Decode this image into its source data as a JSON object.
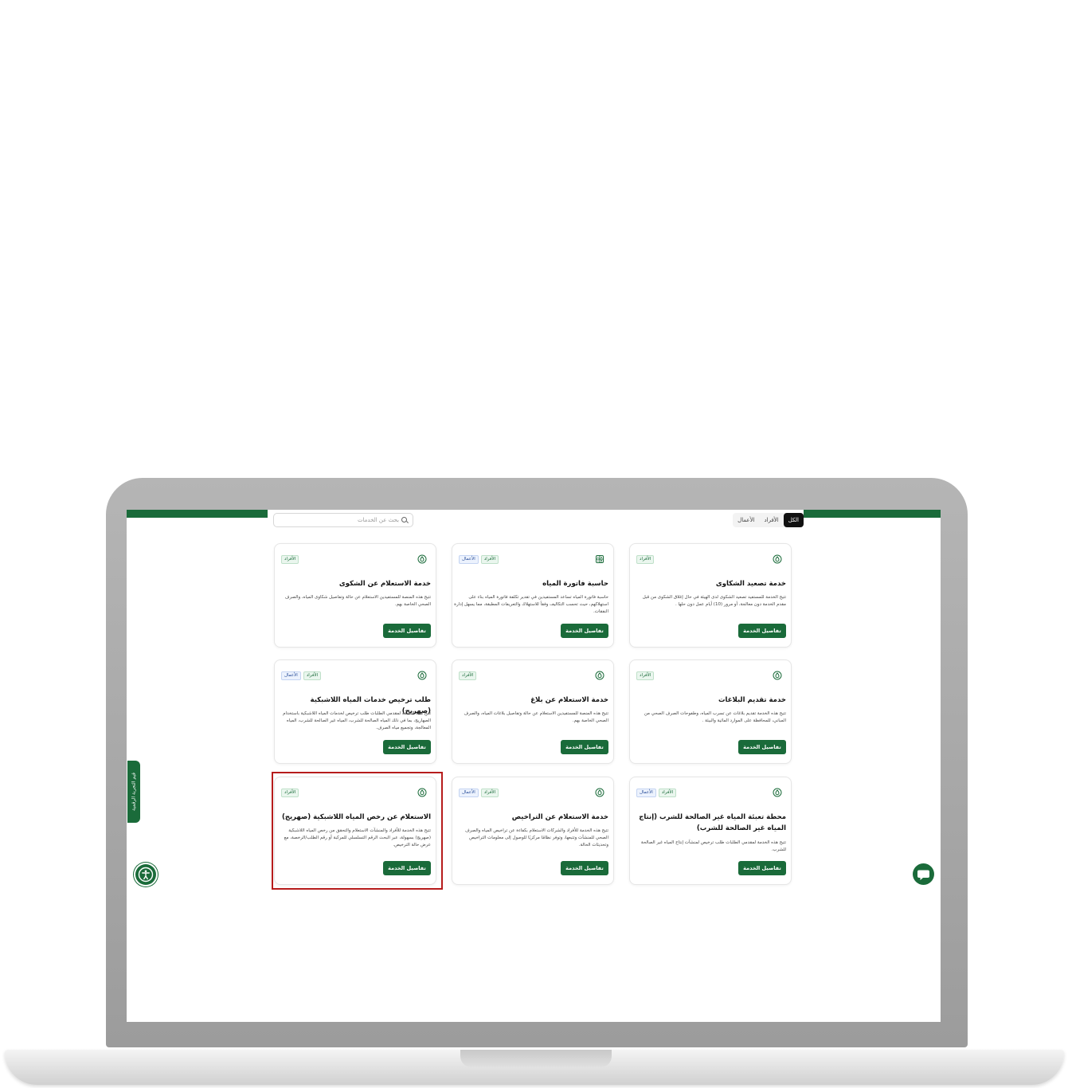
{
  "toolbar": {
    "search_placeholder": "بحث عن الخدمات",
    "tabs": [
      "الكل",
      "الأفراد",
      "الأعمال"
    ]
  },
  "cards": [
    {
      "title": "خدمة تصعيد الشكاوى",
      "description": "تتيح الخدمة للمستفيد تصعيد الشكوى لدى الهيئة في حال إغلاق الشكوى من قبل مقدم الخدمة دون معالجة، أو مرور (10) أيام عمل دون حلها .",
      "badges": [
        "الأفراد"
      ],
      "button": "تفاصيل الخدمة",
      "icon": "droplet-icon"
    },
    {
      "title": "حاسبة فاتورة المياه",
      "description": "حاسبة فاتورة المياه تساعد المستفيدين في تقدير تكلفة فاتورة المياه بناء على استهلاكهم، حيث تحسب التكاليف وفقاً للاستهلاك والتعريفات المطبقة، مما يسهل إدارة النفقات.",
      "badges": [
        "الأفراد",
        "الأعمال"
      ],
      "button": "تفاصيل الخدمة",
      "icon": "calculator-icon"
    },
    {
      "title": "خدمة الاستعلام عن الشكوى",
      "description": "تتيح هذه المنصة للمستفيدين الاستعلام عن حالة وتفاصيل شكاوى المياه، والصرف الصحي الخاصة بهم.",
      "badges": [
        "الأفراد"
      ],
      "button": "تفاصيل الخدمة",
      "icon": "droplet-icon"
    },
    {
      "title": "خدمة تقديم البلاغات",
      "description": "تتيح هذه الخدمة تقديم بلاغات عن تسرب المياه، وطفوحات الصرف الصحي من المباني، للمحافظة على الموارد المائية والبيئة .",
      "badges": [
        "الأفراد"
      ],
      "button": "تفاصيل الخدمة",
      "icon": "droplet-icon"
    },
    {
      "title": "خدمة الاستعلام عن بلاغ",
      "description": "تتيح هذه المنصة للمستفيدين الاستعلام عن حالة وتفاصيل بلاغات المياه، والصرف الصحي الخاصة بهم.",
      "badges": [
        "الأفراد"
      ],
      "button": "تفاصيل الخدمة",
      "icon": "droplet-icon"
    },
    {
      "title": "طلب ترخيص خدمات المياه اللاشبكية (صهريج)",
      "description": "تتيح هذه الخدمة لمقدمي الطلبات طلب ترخيص لخدمات المياه اللاشبكية باستخدام الصهاريج، بما في ذلك المياه الصالحة للشرب، المياه غير الصالحة للشرب، المياه المعالجة، وتجميع مياه الصرف.",
      "badges": [
        "الأفراد",
        "الأعمال"
      ],
      "button": "تفاصيل الخدمة",
      "icon": "droplet-icon"
    },
    {
      "title": "محطة تعبئة المياه غير الصالحة للشرب (إنتاج المياه غير الصالحة للشرب)",
      "description": "تتيح هذه الخدمة لمقدمي الطلبات طلب ترخيص لمنشآت إنتاج المياه غير الصالحة للشرب.",
      "badges": [
        "الأفراد",
        "الأعمال"
      ],
      "button": "تفاصيل الخدمة",
      "icon": "droplet-icon"
    },
    {
      "title": "خدمة الاستعلام عن التراخيص",
      "description": "تتيح هذه الخدمة للأفراد والشركات الاستعلام بكفاءة عن تراخيص المياه والصرف الصحي للمنشآت وتتبعها، وتوفر نظامًا مركزيًا للوصول إلى معلومات التراخيص وتحديثات الحالة.",
      "badges": [
        "الأفراد",
        "الأعمال"
      ],
      "button": "تفاصيل الخدمة",
      "icon": "droplet-icon"
    },
    {
      "title": "الاستعلام عن رخص المياه اللاشبكية (صهريج)",
      "description": "تتيح هذه الخدمة للأفراد والمنشآت الاستعلام والتحقق من رخص المياه اللاشبكية (صهريج) بسهولة، عبر البحث الرقم التسلسلي للمركبة أو رقم الطلب/الرخصة، مع عرض حالة الترخيص.",
      "badges": [
        "الأفراد"
      ],
      "button": "تفاصيل الخدمة",
      "icon": "droplet-icon"
    }
  ],
  "side_tab": "قيم التجربة الرقمية",
  "colors": {
    "primary": "#1a6b3a",
    "highlight": "#b61c1c"
  }
}
